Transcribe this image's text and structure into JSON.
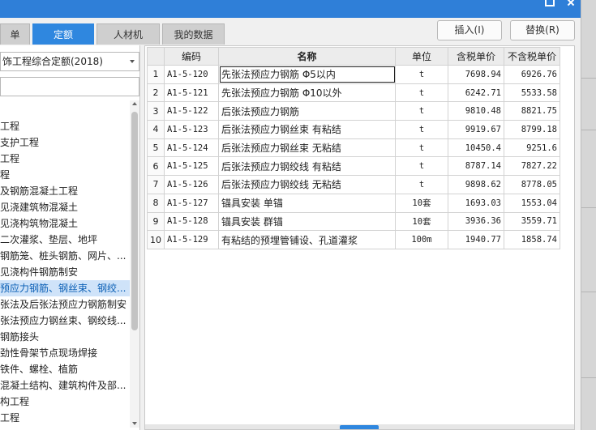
{
  "tabs": [
    {
      "label": "单"
    },
    {
      "label": "定额"
    },
    {
      "label": "人材机"
    },
    {
      "label": "我的数据"
    }
  ],
  "toolbar": {
    "insert_label": "插入(I)",
    "replace_label": "替换(R)"
  },
  "left_panel": {
    "library_selected": "饰工程综合定额(2018)",
    "search_value": "",
    "tree_items": [
      "工程",
      "支护工程",
      "工程",
      "程",
      "及钢筋混凝土工程",
      "见浇建筑物混凝土",
      "见浇构筑物混凝土",
      "二次灌浆、垫层、地坪",
      "钢筋笼、桩头钢筋、网片、...",
      "见浇构件钢筋制安",
      "预应力钢筋、钢丝束、钢绞...",
      "张法及后张法预应力钢筋制安",
      "张法预应力钢丝束、钢绞线...",
      "钢筋接头",
      "劲性骨架节点现场焊接",
      "铁件、螺栓、植筋",
      "混凝土结构、建筑构件及部...",
      "构工程",
      "工程"
    ],
    "selected_index": 10
  },
  "grid": {
    "headers": {
      "rownum": "",
      "code": "编码",
      "name": "名称",
      "unit": "单位",
      "price_tax": "含税单价",
      "price_notax": "不含税单价"
    },
    "rows": [
      {
        "n": "1",
        "code": "A1-5-120",
        "name": "先张法预应力钢筋 Φ5以内",
        "unit": "t",
        "tax": "7698.94",
        "notax": "6926.76"
      },
      {
        "n": "2",
        "code": "A1-5-121",
        "name": "先张法预应力钢筋 Φ10以外",
        "unit": "t",
        "tax": "6242.71",
        "notax": "5533.58"
      },
      {
        "n": "3",
        "code": "A1-5-122",
        "name": "后张法预应力钢筋",
        "unit": "t",
        "tax": "9810.48",
        "notax": "8821.75"
      },
      {
        "n": "4",
        "code": "A1-5-123",
        "name": "后张法预应力钢丝束 有粘结",
        "unit": "t",
        "tax": "9919.67",
        "notax": "8799.18"
      },
      {
        "n": "5",
        "code": "A1-5-124",
        "name": "后张法预应力钢丝束 无粘结",
        "unit": "t",
        "tax": "10450.4",
        "notax": "9251.6"
      },
      {
        "n": "6",
        "code": "A1-5-125",
        "name": "后张法预应力钢绞线 有粘结",
        "unit": "t",
        "tax": "8787.14",
        "notax": "7827.22"
      },
      {
        "n": "7",
        "code": "A1-5-126",
        "name": "后张法预应力钢绞线 无粘结",
        "unit": "t",
        "tax": "9898.62",
        "notax": "8778.05"
      },
      {
        "n": "8",
        "code": "A1-5-127",
        "name": "锚具安装 单锚",
        "unit": "10套",
        "tax": "1693.03",
        "notax": "1553.04"
      },
      {
        "n": "9",
        "code": "A1-5-128",
        "name": "锚具安装 群锚",
        "unit": "10套",
        "tax": "3936.36",
        "notax": "3559.71"
      },
      {
        "n": "10",
        "code": "A1-5-129",
        "name": "有粘结的预埋管铺设、孔道灌浆",
        "unit": "100m",
        "tax": "1940.77",
        "notax": "1858.74"
      }
    ],
    "selected_row": 0
  },
  "colors": {
    "accent": "#2f87df",
    "titlebar": "#2f7fd8",
    "selection": "#cfe3f9"
  }
}
